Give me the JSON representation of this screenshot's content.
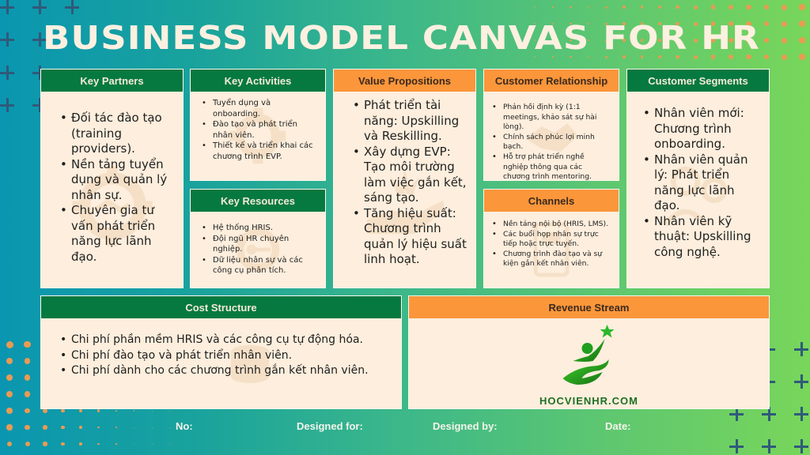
{
  "title": "Business Model Canvas for HR",
  "colors": {
    "header_green": "#067940",
    "header_orange": "#fb963b",
    "panel_bg": "#fdeedd",
    "title_text": "#fdf0e0",
    "deco_orange": "#ea9a52",
    "deco_plus": "#2f5a7a"
  },
  "key_partners": {
    "label": "Key Partners",
    "icon": "gear-handshake-icon",
    "items": [
      "Đối tác đào tạo (training providers).",
      "Nền tảng tuyển dụng và quản lý nhân sự.",
      "Chuyên gia tư vấn phát triển năng lực lãnh đạo."
    ]
  },
  "key_activities": {
    "label": "Key Activities",
    "icon": "gear-icon",
    "items": [
      "Tuyển dụng và onboarding.",
      "Đào tạo và phát triển nhân viên.",
      "Thiết kế và triển khai các chương trình EVP."
    ]
  },
  "key_resources": {
    "label": "Key Resources",
    "icon": "gear-key-icon",
    "items": [
      "Hệ thống HRIS.",
      "Đội ngũ HR chuyên nghiệp.",
      "Dữ liệu nhân sự và các công cụ phân tích."
    ]
  },
  "value_propositions": {
    "label": "Value Propositions",
    "icon": "hand-gift-icon",
    "items": [
      "Phát triển tài năng: Upskilling và Reskilling.",
      "Xây dựng EVP: Tạo môi trường làm việc gắn kết, sáng tạo.",
      "Tăng hiệu suất: Chương trình quản lý hiệu suất linh hoạt."
    ]
  },
  "customer_relationship": {
    "label": "Customer Relationship",
    "icon": "handshake-icon",
    "items": [
      "Phản hồi định kỳ (1:1 meetings, khảo sát sự hài lòng).",
      "Chính sách phúc lợi minh bạch.",
      "Hỗ trợ phát triển nghề nghiệp thông qua các chương trình mentoring."
    ]
  },
  "channels": {
    "label": "Channels",
    "icon": "truck-icon",
    "items": [
      "Nền tảng nội bộ (HRIS, LMS).",
      "Các buổi họp nhân sự trực tiếp hoặc trực tuyến.",
      "Chương trình đào tạo và sự kiện gắn kết nhân viên."
    ]
  },
  "customer_segments": {
    "label": "Customer Segments",
    "icon": "people-icon",
    "items": [
      "Nhân viên mới: Chương trình onboarding.",
      "Nhân viên quản lý: Phát triển năng lực lãnh đạo.",
      "Nhân viên kỹ thuật: Upskilling công nghệ."
    ]
  },
  "cost_structure": {
    "label": "Cost Structure",
    "icon": "coins-icon",
    "items": [
      "Chi phí phần mềm HRIS và các công cụ tự động hóa.",
      "Chi phí đào tạo và phát triển nhân viên.",
      "Chi phí dành cho các chương trình gắn kết nhân viên."
    ]
  },
  "revenue_stream": {
    "label": "Revenue Stream",
    "logo_text": "HOCVIENHR.COM"
  },
  "footer": {
    "no_label": "No:",
    "designed_for_label": "Designed for:",
    "designed_by_label": "Designed by:",
    "date_label": "Date:"
  }
}
